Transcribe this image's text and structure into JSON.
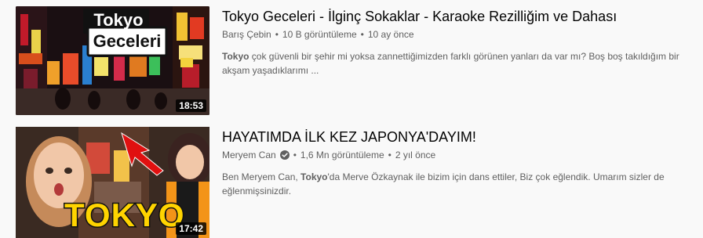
{
  "results": [
    {
      "title": "Tokyo Geceleri - İlginç Sokaklar - Karaoke Rezilliğim ve Dahası",
      "channel": "Barış Çebin",
      "views": "10 B görüntüleme",
      "age": "10 ay önce",
      "description_bold": "Tokyo",
      "description_rest": " çok güvenli bir şehir mi yoksa zannettiğimizden farklı görünen yanları da var mı? Boş boş takıldığım bir akşam yaşadıklarımı ...",
      "duration": "18:53",
      "thumb_text_line1": "Tokyo",
      "thumb_text_line2": "Geceleri"
    },
    {
      "title": "HAYATIMDA İLK KEZ JAPONYA'DAYIM!",
      "channel": "Meryem Can",
      "verified": true,
      "views": "1,6 Mn görüntüleme",
      "age": "2 yıl önce",
      "description_pre": "Ben Meryem Can, ",
      "description_bold": "Tokyo",
      "description_rest": "'da Merve Özkaynak ile bizim için dans ettiler, Biz çok eğlendik. Umarım sizler de eğlenmişsinizdir.",
      "duration": "17:42",
      "thumb_text": "TOKYO"
    }
  ],
  "separator": "•",
  "colors": {
    "background": "#f9f9f9",
    "title": "#030303",
    "meta": "#606060",
    "thumb_yellow": "#ffd400",
    "arrow_red": "#e01010"
  }
}
